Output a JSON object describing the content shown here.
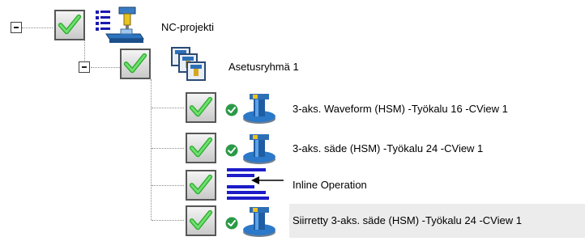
{
  "tree": {
    "root": {
      "label": "NC-projekti",
      "expanded": true,
      "icon": "machine-icon",
      "children": [
        {
          "label": "Asetusryhmä 1",
          "expanded": true,
          "icon": "toolgroup-icon",
          "operations": [
            {
              "label": "3-aks. Waveform (HSM) -Työkalu 16 -CView 1",
              "status": "ok",
              "icon": "toolpath-icon"
            },
            {
              "label": "3-aks. säde (HSM) -Työkalu 24 -CView 1",
              "status": "ok",
              "icon": "toolpath-icon"
            },
            {
              "label": "Inline Operation",
              "status": "none",
              "icon": "inline-operation-icon"
            },
            {
              "label": "Siirretty 3-aks. säde (HSM) -Työkalu 24 -CView 1",
              "status": "ok",
              "icon": "toolpath-icon",
              "selected": true
            }
          ]
        }
      ]
    }
  },
  "colors": {
    "check_green": "#3cc43c",
    "ok_badge": "#2a9a46",
    "tool_blue": "#1f5fa8",
    "inline_blue": "#1c1cc8",
    "selection_bg": "#ececec"
  }
}
